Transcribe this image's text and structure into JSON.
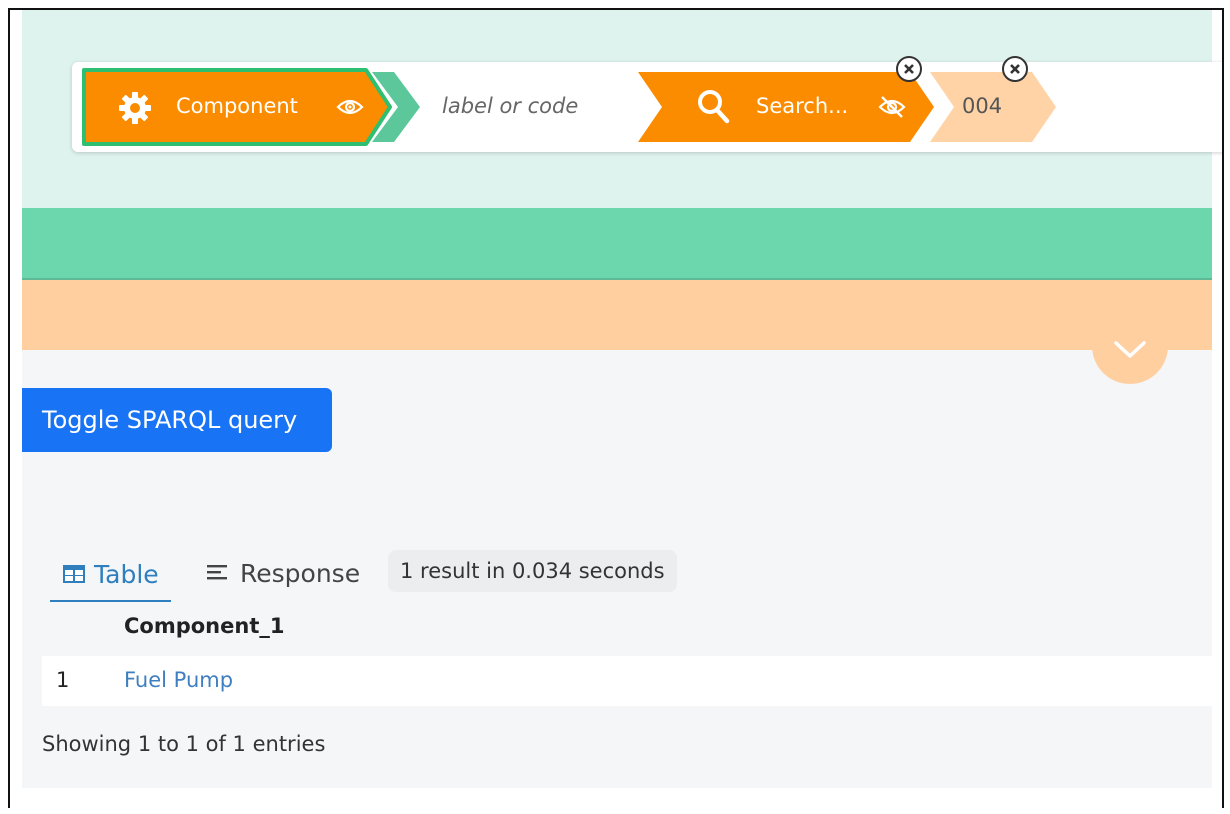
{
  "query_builder": {
    "chips": [
      {
        "label": "Component",
        "icon": "gear-icon",
        "visibility_icon": "eye-icon",
        "color": "#fb8c00",
        "border": "#2fbf71"
      },
      {
        "placeholder": "label or code"
      },
      {
        "label": "Search...",
        "icon": "search-icon",
        "visibility_icon": "eye-off-icon",
        "color": "#fb8c00"
      },
      {
        "label": "004",
        "color": "#ffd3a6"
      }
    ]
  },
  "sparql": {
    "toggle_label": "Toggle SPARQL query"
  },
  "results": {
    "tabs": [
      {
        "label": "Table",
        "icon": "table-icon"
      },
      {
        "label": "Response",
        "icon": "align-left-icon"
      }
    ],
    "summary": "1 result in 0.034 seconds",
    "columns": [
      "Component_1"
    ],
    "rows": [
      {
        "index": "1",
        "value": "Fuel Pump"
      }
    ],
    "footer": "Showing 1 to 1 of 1 entries"
  },
  "colors": {
    "accent_orange": "#fb8c00",
    "green": "#6cd6ac",
    "peach": "#ffcf9f",
    "blue_button": "#1973f5"
  }
}
